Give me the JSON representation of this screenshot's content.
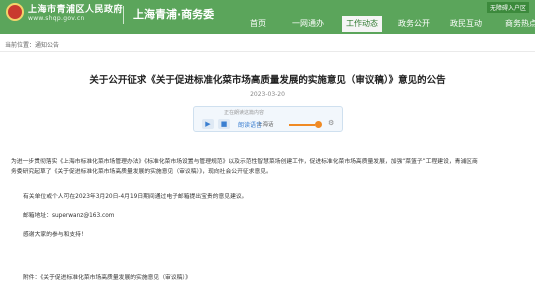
{
  "header": {
    "gov_name": "上海市青浦区人民政府",
    "gov_url": "www.shqp.gov.cn",
    "site_name": "上海青浦·商务委",
    "topbar_link": "无障碍入户区"
  },
  "nav": {
    "items": [
      {
        "label": "首页"
      },
      {
        "label": "一网通办"
      },
      {
        "label": "工作动态"
      },
      {
        "label": "政务公开"
      },
      {
        "label": "政民互动"
      },
      {
        "label": "商务热点"
      }
    ],
    "active_index": 2
  },
  "breadcrumb": "当前位置：通知公告",
  "article": {
    "title": "关于公开征求《关于促进标准化菜市场高质量发展的实施意见（审议稿）》意见的公告",
    "date": "2023-03-20",
    "player": {
      "top_label": "正在朗读这篇内容",
      "speaker": "朗读语音",
      "voice": "上海话",
      "progress": 0.85
    },
    "paragraphs": [
      "为进一步贯彻落实《上海市标准化菜市场管理办法》《标准化菜市场设置与管理规范》以及示范性智慧菜场创建工作，促进标准化菜市场高质量发展，加强“菜篮子”工程建设，青浦区商",
      "务委研究起草了《关于促进标准化菜市场高质量发展的实施意见（审议稿）》，现向社会公开征求意见。",
      "有关单位或个人可在2023年3月20日-4月19日期间通过电子邮箱提出宝贵的意见建议。",
      "邮箱地址：superwanz@163.com",
      "感谢大家的参与和支持！",
      "附件：《关于促进标准化菜市场高质量发展的实施意见（审议稿）》"
    ]
  }
}
